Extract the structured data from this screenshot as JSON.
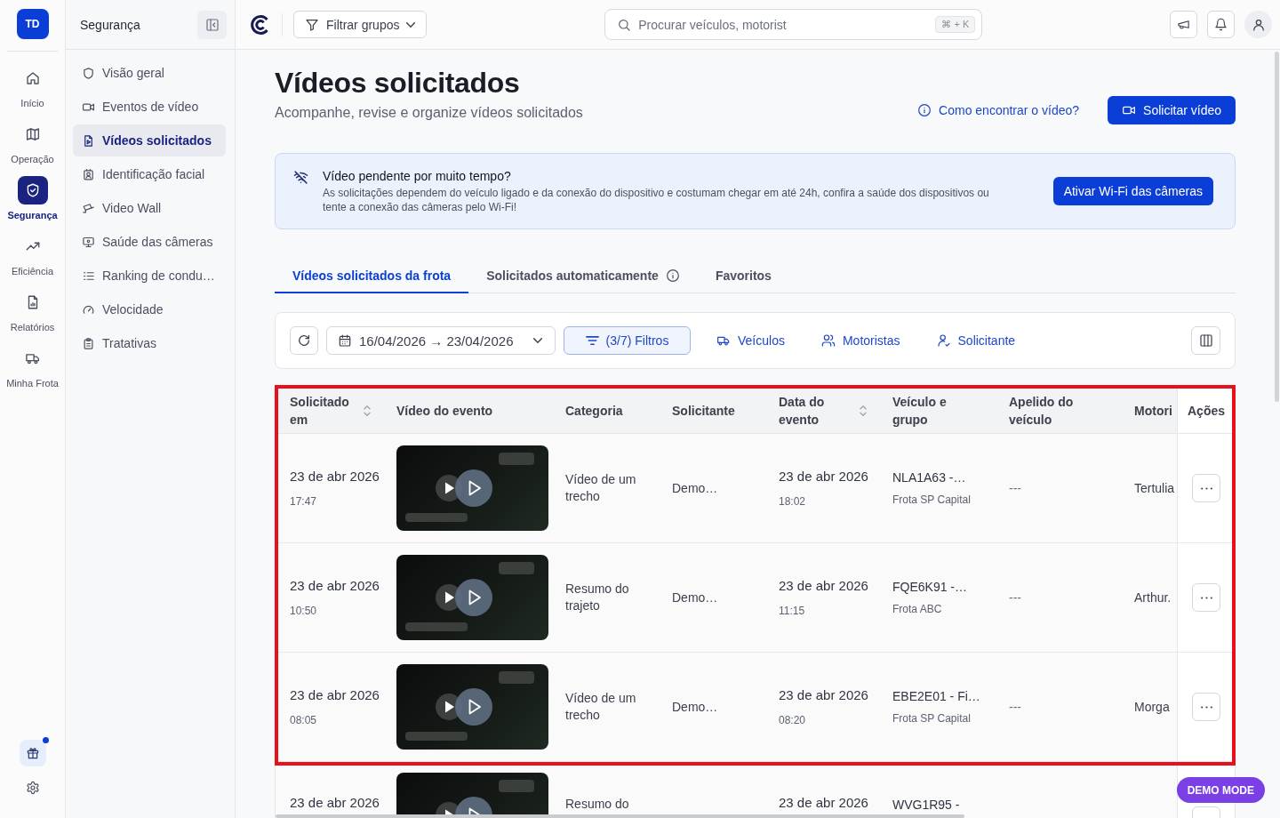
{
  "rail": {
    "avatar": "TD",
    "items": [
      {
        "label": "Início",
        "selected": false
      },
      {
        "label": "Operação",
        "selected": false
      },
      {
        "label": "Segurança",
        "selected": true
      },
      {
        "label": "Eficiência",
        "selected": false
      },
      {
        "label": "Relatórios",
        "selected": false
      },
      {
        "label": "Minha Frota",
        "selected": false
      }
    ],
    "gift_notification": true
  },
  "sidebar": {
    "title": "Segurança",
    "items": [
      {
        "label": "Visão geral",
        "selected": false
      },
      {
        "label": "Eventos de vídeo",
        "selected": false
      },
      {
        "label": "Vídeos solicitados",
        "selected": true
      },
      {
        "label": "Identificação facial",
        "selected": false
      },
      {
        "label": "Video Wall",
        "selected": false
      },
      {
        "label": "Saúde das câmeras",
        "selected": false
      },
      {
        "label": "Ranking de condu…",
        "selected": false
      },
      {
        "label": "Velocidade",
        "selected": false
      },
      {
        "label": "Tratativas",
        "selected": false
      }
    ]
  },
  "topbar": {
    "group_filter": "Filtrar grupos",
    "search": {
      "placeholder": "Procurar veículos, motorist",
      "shortcut": "⌘ + K"
    }
  },
  "header": {
    "title": "Vídeos solicitados",
    "subtitle": "Acompanhe, revise e organize vídeos solicitados",
    "help_link": "Como encontrar o vídeo?",
    "request_button": "Solicitar vídeo"
  },
  "banner": {
    "title": "Vídeo pendente por muito tempo?",
    "text": "As solicitações dependem do veículo ligado e da conexão do dispositivo e costumam chegar em até 24h, confira a saúde dos dispositivos ou tente a conexão das câmeras pelo Wi-Fi!",
    "button": "Ativar Wi-Fi das câmeras"
  },
  "tabs": [
    {
      "label": "Vídeos solicitados da frota",
      "selected": true,
      "info": false
    },
    {
      "label": "Solicitados automaticamente",
      "selected": false,
      "info": true
    },
    {
      "label": "Favoritos",
      "selected": false,
      "info": false
    }
  ],
  "filters": {
    "date_range": "16/04/2026 → 23/04/2026",
    "filters_button": "(3/7) Filtros",
    "links": [
      "Veículos",
      "Motoristas",
      "Solicitante"
    ]
  },
  "table": {
    "columns": [
      {
        "label": "Solicitado em",
        "sortable": true,
        "pinned": false
      },
      {
        "label": "Vídeo do evento",
        "sortable": false,
        "pinned": false
      },
      {
        "label": "Categoria",
        "sortable": false,
        "pinned": false
      },
      {
        "label": "Solicitante",
        "sortable": false,
        "pinned": false
      },
      {
        "label": "Data do evento",
        "sortable": true,
        "pinned": false
      },
      {
        "label": "Veículo e grupo",
        "sortable": false,
        "pinned": false
      },
      {
        "label": "Apelido do veículo",
        "sortable": false,
        "pinned": false
      },
      {
        "label": "Motori",
        "sortable": false,
        "pinned": false
      },
      {
        "label": "Ações",
        "sortable": false,
        "pinned": true
      }
    ],
    "rows": [
      {
        "requested_date": "23 de abr 2026",
        "requested_time": "17:47",
        "category": "Vídeo de um trecho",
        "requester": "Demo…",
        "event_date": "23 de abr 2026",
        "event_time": "18:02",
        "vehicle": "NLA1A63 -…",
        "group": "Frota SP Capital",
        "nickname": "---",
        "driver": "Tertulia",
        "highlighted": true
      },
      {
        "requested_date": "23 de abr 2026",
        "requested_time": "10:50",
        "category": "Resumo do trajeto",
        "requester": "Demo…",
        "event_date": "23 de abr 2026",
        "event_time": "11:15",
        "vehicle": "FQE6K91 -…",
        "group": "Frota ABC",
        "nickname": "---",
        "driver": "Arthur.",
        "highlighted": true
      },
      {
        "requested_date": "23 de abr 2026",
        "requested_time": "08:05",
        "category": "Vídeo de um trecho",
        "requester": "Demo…",
        "event_date": "23 de abr 2026",
        "event_time": "08:20",
        "vehicle": "EBE2E01 - Fi…",
        "group": "Frota SP Capital",
        "nickname": "---",
        "driver": "Morga",
        "highlighted": true
      },
      {
        "requested_date": "23 de abr 2026",
        "category": "Resumo do",
        "event_date": "23 de abr 2026",
        "vehicle": "WVG1R95 -",
        "highlighted": false
      }
    ]
  },
  "demo_badge": "DEMO MODE"
}
